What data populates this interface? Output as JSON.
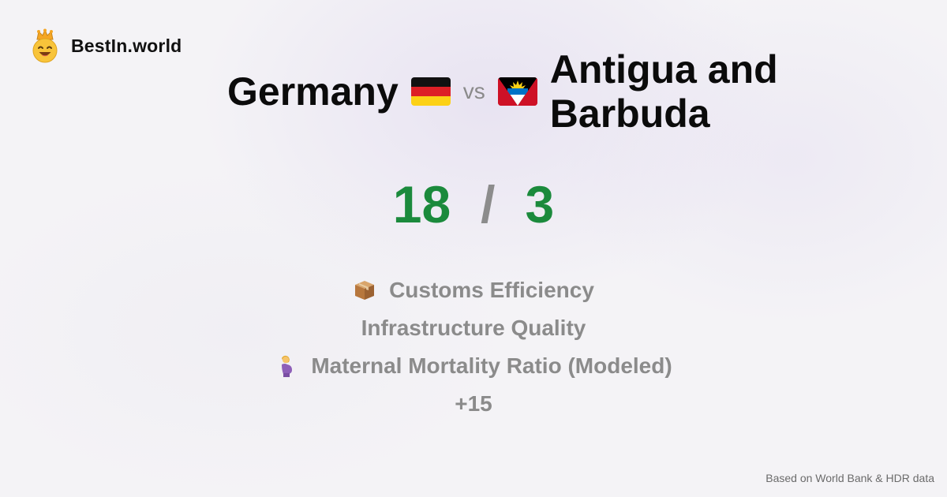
{
  "brand": {
    "name": "BestIn.world",
    "icon": "crowned-smiley-icon"
  },
  "comparison": {
    "country_a": "Germany",
    "country_a_flag": "germany-flag-icon",
    "vs_label": "vs",
    "country_b": "Antigua and Barbuda",
    "country_b_flag": "antigua-barbuda-flag-icon"
  },
  "score": {
    "a": "18",
    "separator": "/",
    "b": "3",
    "color": "#1b8a3c"
  },
  "categories": [
    {
      "icon": "package-icon",
      "label": "Customs Efficiency"
    },
    {
      "icon": "",
      "label": "Infrastructure Quality"
    },
    {
      "icon": "pregnant-woman-icon",
      "label": "Maternal Mortality Ratio (Modeled)"
    }
  ],
  "more_label": "+15",
  "footer": {
    "source": "Based on World Bank & HDR data"
  }
}
